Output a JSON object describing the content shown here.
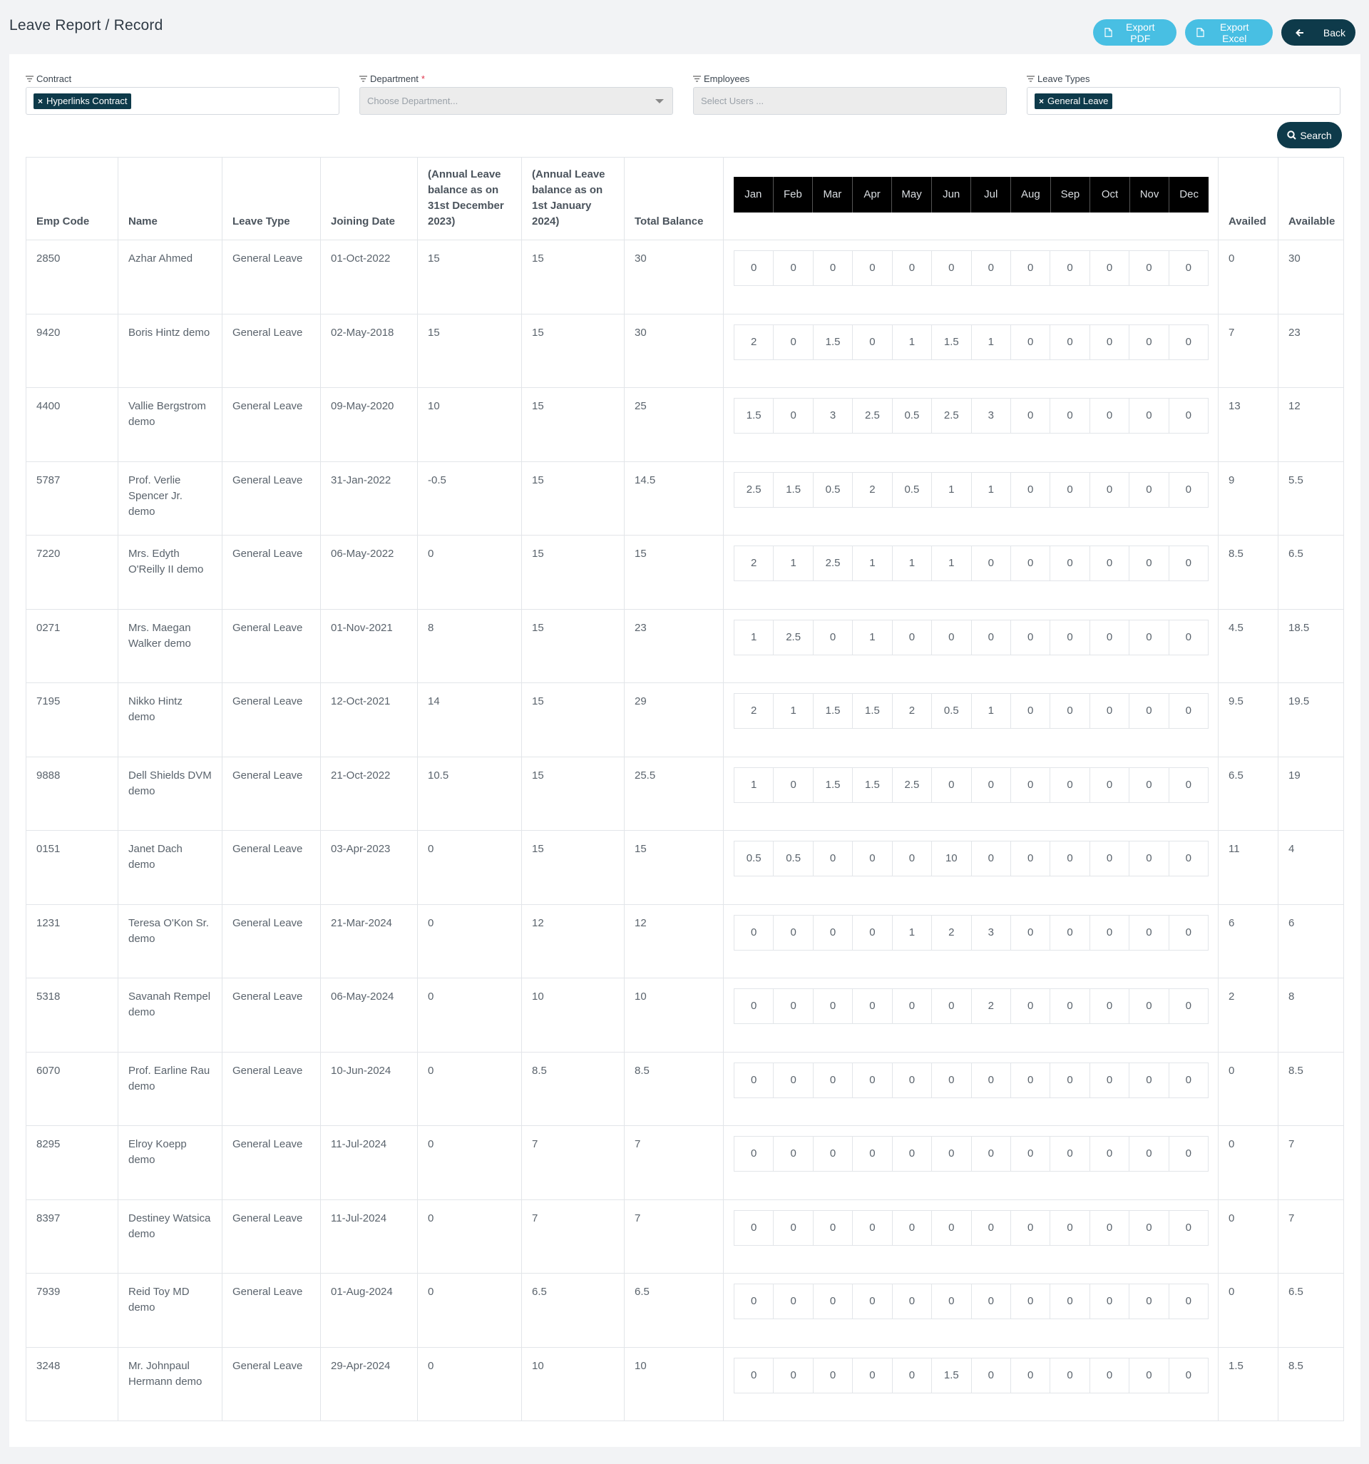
{
  "page": {
    "title": "Leave Report / Record"
  },
  "actions": {
    "export_pdf": "Export PDF",
    "export_excel": "Export Excel",
    "back": "Back"
  },
  "filters": {
    "contract": {
      "label": "Contract",
      "tag": "Hyperlinks Contract"
    },
    "department": {
      "label": "Department",
      "required": "*",
      "placeholder": "Choose Department..."
    },
    "employees": {
      "label": "Employees",
      "placeholder": "Select Users ..."
    },
    "leave_types": {
      "label": "Leave Types",
      "tag": "General Leave"
    },
    "search": "Search"
  },
  "table": {
    "headers": {
      "emp_code": "Emp Code",
      "name": "Name",
      "leave_type": "Leave Type",
      "joining_date": "Joining Date",
      "bal_dec": "(Annual Leave balance as on 31st December 2023)",
      "bal_jan": "(Annual Leave balance as on 1st January 2024)",
      "total": "Total Balance",
      "availed": "Availed",
      "available": "Available"
    },
    "months": [
      "Jan",
      "Feb",
      "Mar",
      "Apr",
      "May",
      "Jun",
      "Jul",
      "Aug",
      "Sep",
      "Oct",
      "Nov",
      "Dec"
    ],
    "rows": [
      {
        "code": "2850",
        "name": "Azhar Ahmed",
        "type": "General Leave",
        "joined": "01-Oct-2022",
        "bal_dec": "15",
        "bal_jan": "15",
        "total": "30",
        "months": [
          "0",
          "0",
          "0",
          "0",
          "0",
          "0",
          "0",
          "0",
          "0",
          "0",
          "0",
          "0"
        ],
        "availed": "0",
        "available": "30"
      },
      {
        "code": "9420",
        "name": "Boris Hintz demo",
        "type": "General Leave",
        "joined": "02-May-2018",
        "bal_dec": "15",
        "bal_jan": "15",
        "total": "30",
        "months": [
          "2",
          "0",
          "1.5",
          "0",
          "1",
          "1.5",
          "1",
          "0",
          "0",
          "0",
          "0",
          "0"
        ],
        "availed": "7",
        "available": "23"
      },
      {
        "code": "4400",
        "name": "Vallie Bergstrom demo",
        "type": "General Leave",
        "joined": "09-May-2020",
        "bal_dec": "10",
        "bal_jan": "15",
        "total": "25",
        "months": [
          "1.5",
          "0",
          "3",
          "2.5",
          "0.5",
          "2.5",
          "3",
          "0",
          "0",
          "0",
          "0",
          "0"
        ],
        "availed": "13",
        "available": "12"
      },
      {
        "code": "5787",
        "name": "Prof. Verlie Spencer Jr. demo",
        "type": "General Leave",
        "joined": "31-Jan-2022",
        "bal_dec": "-0.5",
        "bal_jan": "15",
        "total": "14.5",
        "months": [
          "2.5",
          "1.5",
          "0.5",
          "2",
          "0.5",
          "1",
          "1",
          "0",
          "0",
          "0",
          "0",
          "0"
        ],
        "availed": "9",
        "available": "5.5"
      },
      {
        "code": "7220",
        "name": "Mrs. Edyth O'Reilly II demo",
        "type": "General Leave",
        "joined": "06-May-2022",
        "bal_dec": "0",
        "bal_jan": "15",
        "total": "15",
        "months": [
          "2",
          "1",
          "2.5",
          "1",
          "1",
          "1",
          "0",
          "0",
          "0",
          "0",
          "0",
          "0"
        ],
        "availed": "8.5",
        "available": "6.5"
      },
      {
        "code": "0271",
        "name": "Mrs. Maegan Walker demo",
        "type": "General Leave",
        "joined": "01-Nov-2021",
        "bal_dec": "8",
        "bal_jan": "15",
        "total": "23",
        "months": [
          "1",
          "2.5",
          "0",
          "1",
          "0",
          "0",
          "0",
          "0",
          "0",
          "0",
          "0",
          "0"
        ],
        "availed": "4.5",
        "available": "18.5"
      },
      {
        "code": "7195",
        "name": "Nikko Hintz demo",
        "type": "General Leave",
        "joined": "12-Oct-2021",
        "bal_dec": "14",
        "bal_jan": "15",
        "total": "29",
        "months": [
          "2",
          "1",
          "1.5",
          "1.5",
          "2",
          "0.5",
          "1",
          "0",
          "0",
          "0",
          "0",
          "0"
        ],
        "availed": "9.5",
        "available": "19.5"
      },
      {
        "code": "9888",
        "name": "Dell Shields DVM demo",
        "type": "General Leave",
        "joined": "21-Oct-2022",
        "bal_dec": "10.5",
        "bal_jan": "15",
        "total": "25.5",
        "months": [
          "1",
          "0",
          "1.5",
          "1.5",
          "2.5",
          "0",
          "0",
          "0",
          "0",
          "0",
          "0",
          "0"
        ],
        "availed": "6.5",
        "available": "19"
      },
      {
        "code": "0151",
        "name": "Janet Dach demo",
        "type": "General Leave",
        "joined": "03-Apr-2023",
        "bal_dec": "0",
        "bal_jan": "15",
        "total": "15",
        "months": [
          "0.5",
          "0.5",
          "0",
          "0",
          "0",
          "10",
          "0",
          "0",
          "0",
          "0",
          "0",
          "0"
        ],
        "availed": "11",
        "available": "4"
      },
      {
        "code": "1231",
        "name": "Teresa O'Kon Sr. demo",
        "type": "General Leave",
        "joined": "21-Mar-2024",
        "bal_dec": "0",
        "bal_jan": "12",
        "total": "12",
        "months": [
          "0",
          "0",
          "0",
          "0",
          "1",
          "2",
          "3",
          "0",
          "0",
          "0",
          "0",
          "0"
        ],
        "availed": "6",
        "available": "6"
      },
      {
        "code": "5318",
        "name": "Savanah Rempel demo",
        "type": "General Leave",
        "joined": "06-May-2024",
        "bal_dec": "0",
        "bal_jan": "10",
        "total": "10",
        "months": [
          "0",
          "0",
          "0",
          "0",
          "0",
          "0",
          "2",
          "0",
          "0",
          "0",
          "0",
          "0"
        ],
        "availed": "2",
        "available": "8"
      },
      {
        "code": "6070",
        "name": "Prof. Earline Rau demo",
        "type": "General Leave",
        "joined": "10-Jun-2024",
        "bal_dec": "0",
        "bal_jan": "8.5",
        "total": "8.5",
        "months": [
          "0",
          "0",
          "0",
          "0",
          "0",
          "0",
          "0",
          "0",
          "0",
          "0",
          "0",
          "0"
        ],
        "availed": "0",
        "available": "8.5"
      },
      {
        "code": "8295",
        "name": "Elroy Koepp demo",
        "type": "General Leave",
        "joined": "11-Jul-2024",
        "bal_dec": "0",
        "bal_jan": "7",
        "total": "7",
        "months": [
          "0",
          "0",
          "0",
          "0",
          "0",
          "0",
          "0",
          "0",
          "0",
          "0",
          "0",
          "0"
        ],
        "availed": "0",
        "available": "7"
      },
      {
        "code": "8397",
        "name": "Destiney Watsica demo",
        "type": "General Leave",
        "joined": "11-Jul-2024",
        "bal_dec": "0",
        "bal_jan": "7",
        "total": "7",
        "months": [
          "0",
          "0",
          "0",
          "0",
          "0",
          "0",
          "0",
          "0",
          "0",
          "0",
          "0",
          "0"
        ],
        "availed": "0",
        "available": "7"
      },
      {
        "code": "7939",
        "name": "Reid Toy MD demo",
        "type": "General Leave",
        "joined": "01-Aug-2024",
        "bal_dec": "0",
        "bal_jan": "6.5",
        "total": "6.5",
        "months": [
          "0",
          "0",
          "0",
          "0",
          "0",
          "0",
          "0",
          "0",
          "0",
          "0",
          "0",
          "0"
        ],
        "availed": "0",
        "available": "6.5"
      },
      {
        "code": "3248",
        "name": "Mr. Johnpaul Hermann demo",
        "type": "General Leave",
        "joined": "29-Apr-2024",
        "bal_dec": "0",
        "bal_jan": "10",
        "total": "10",
        "months": [
          "0",
          "0",
          "0",
          "0",
          "0",
          "1.5",
          "0",
          "0",
          "0",
          "0",
          "0",
          "0"
        ],
        "availed": "1.5",
        "available": "8.5"
      }
    ]
  }
}
